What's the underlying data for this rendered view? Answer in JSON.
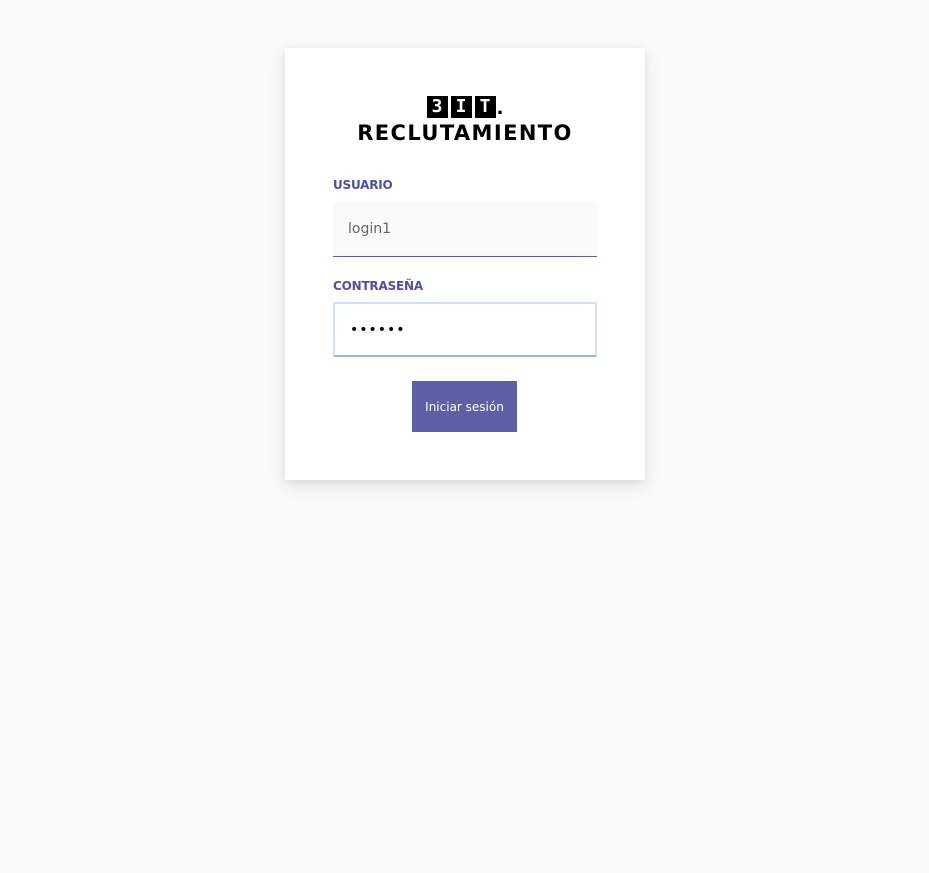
{
  "logo": {
    "mark_chars": [
      "3",
      "I",
      "T"
    ],
    "mark_dot": ".",
    "title": "RECLUTAMIENTO"
  },
  "form": {
    "user_label": "USUARIO",
    "user_value": "login1",
    "password_label": "CONTRASEÑA",
    "password_value": "••••••",
    "submit_label": "Iniciar sesión"
  },
  "colors": {
    "background": "#fafafa",
    "card": "#ffffff",
    "label": "#4d4fa8",
    "button": "#5e5fa6",
    "focus_border": "#cfe0fb"
  }
}
